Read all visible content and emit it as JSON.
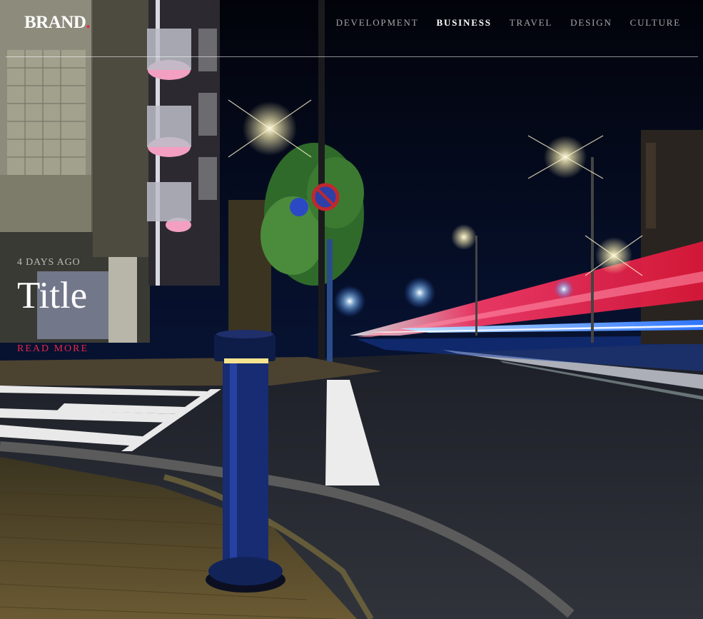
{
  "brand": {
    "name": "BRAND",
    "dot": "."
  },
  "nav": {
    "items": [
      {
        "label": "DEVELOPMENT"
      },
      {
        "label": "BUSINESS"
      },
      {
        "label": "TRAVEL"
      },
      {
        "label": "DESIGN"
      },
      {
        "label": "CULTURE"
      }
    ],
    "active": "BUSINESS"
  },
  "post": {
    "date": "4 DAYS AGO",
    "title": "Title",
    "read_more": "READ MORE"
  },
  "colors": {
    "accent": "#e8254b",
    "text": "#ffffff",
    "nav_text": "#a7a7a7"
  }
}
